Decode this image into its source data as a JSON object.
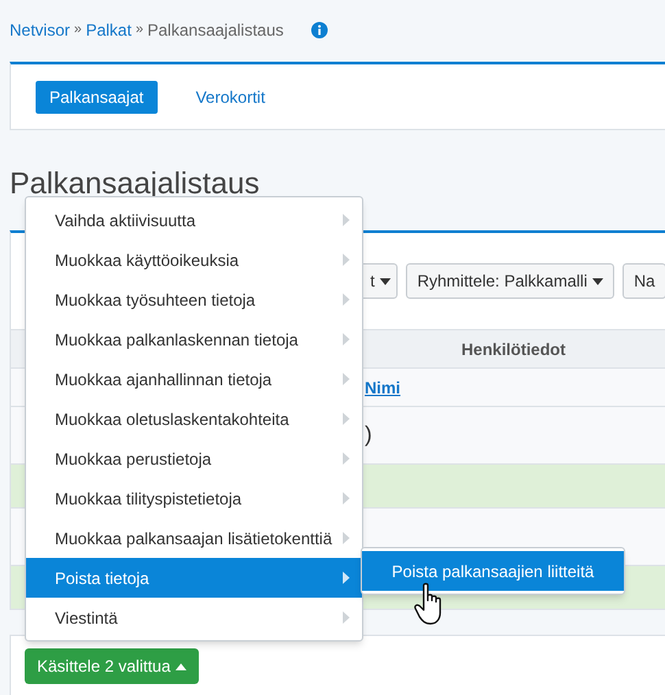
{
  "breadcrumb": {
    "separator": "»",
    "items": [
      {
        "label": "Netvisor",
        "link": true
      },
      {
        "label": "Palkat",
        "link": true
      },
      {
        "label": "Palkansaajalistaus",
        "link": false
      }
    ]
  },
  "tabs": [
    {
      "label": "Palkansaajat",
      "selected": true
    },
    {
      "label": "Verokortit",
      "selected": false
    }
  ],
  "heading": "Palkansaajalistaus",
  "toolbar": [
    {
      "label": "t",
      "caret": true
    },
    {
      "label": "Ryhmittele: Palkkamalli",
      "caret": true
    },
    {
      "label": "Na",
      "caret": false
    }
  ],
  "table": {
    "columns": [
      {
        "label": "Henkilötiedot"
      }
    ],
    "sort_link": "Nimi",
    "rows": [
      {
        "cell": ")",
        "selected": false
      },
      {
        "selected": true
      },
      {
        "selected": false
      },
      {
        "selected": true
      }
    ]
  },
  "bulk_button": "Käsittele 2 valittua",
  "menu": {
    "items": [
      {
        "label": "Vaihda aktiivisuutta",
        "selected": false
      },
      {
        "label": "Muokkaa käyttöoikeuksia",
        "selected": false
      },
      {
        "label": "Muokkaa työsuhteen tietoja",
        "selected": false
      },
      {
        "label": "Muokkaa palkanlaskennan tietoja",
        "selected": false
      },
      {
        "label": "Muokkaa ajanhallinnan tietoja",
        "selected": false
      },
      {
        "label": "Muokkaa oletuslaskentakohteita",
        "selected": false
      },
      {
        "label": "Muokkaa perustietoja",
        "selected": false
      },
      {
        "label": "Muokkaa tilityspistetietoja",
        "selected": false
      },
      {
        "label": "Muokkaa palkansaajan lisätietokenttiä",
        "selected": false
      },
      {
        "label": "Poista tietoja",
        "selected": true
      },
      {
        "label": "Viestintä",
        "selected": false
      }
    ]
  },
  "submenu": {
    "items": [
      {
        "label": "Poista palkansaajien liitteitä",
        "selected": true
      }
    ]
  }
}
